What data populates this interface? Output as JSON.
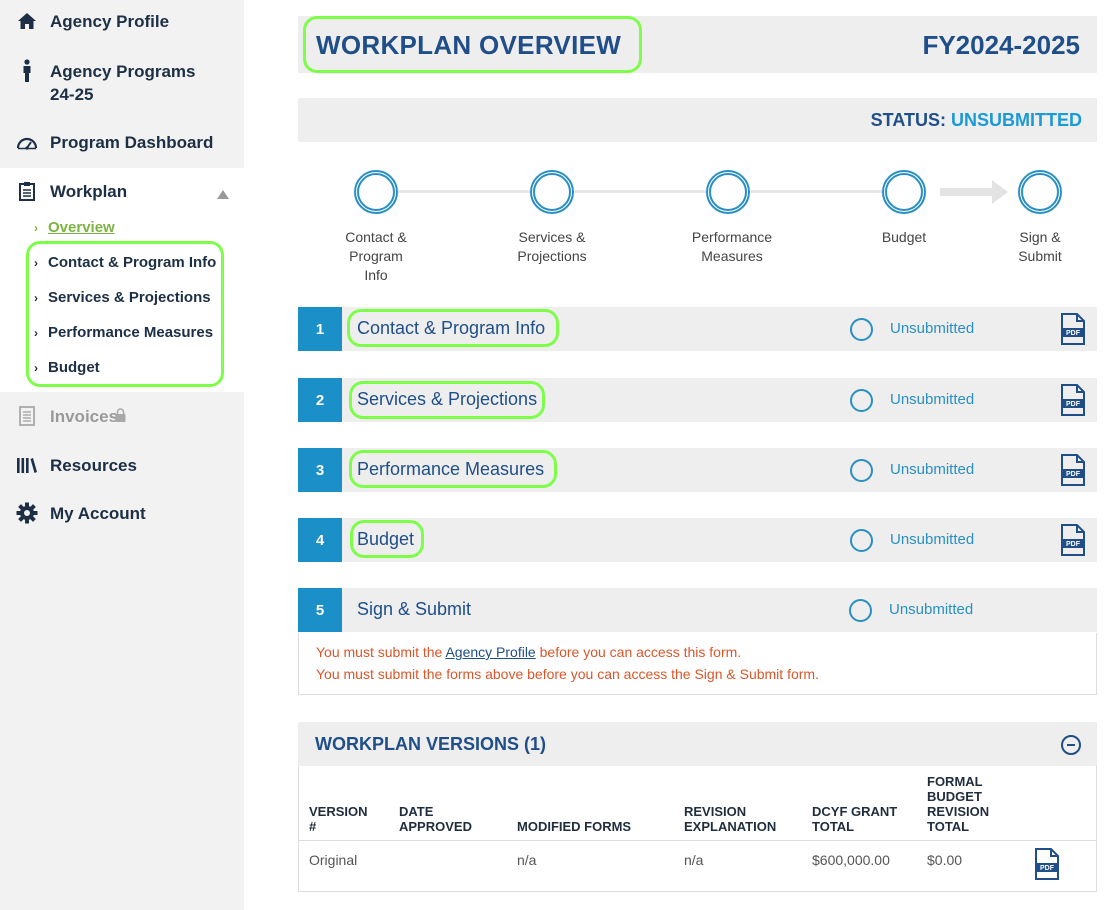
{
  "sidebar": {
    "agency_profile": "Agency Profile",
    "agency_programs": "Agency Programs",
    "agency_programs_year": "24-25",
    "program_dashboard": "Program Dashboard",
    "workplan": "Workplan",
    "sub_items": [
      "Overview",
      "Contact & Program Info",
      "Services & Projections",
      "Performance Measures",
      "Budget"
    ],
    "invoices": "Invoices",
    "resources": "Resources",
    "my_account": "My Account"
  },
  "header": {
    "title": "WORKPLAN OVERVIEW",
    "fiscal_year": "FY2024-2025"
  },
  "status": {
    "label": "STATUS:",
    "value": "UNSUBMITTED"
  },
  "steps": [
    {
      "line1": "Contact &",
      "line2": "Program",
      "line3": "Info"
    },
    {
      "line1": "Services &",
      "line2": "Projections",
      "line3": ""
    },
    {
      "line1": "Performance",
      "line2": "Measures",
      "line3": ""
    },
    {
      "line1": "Budget",
      "line2": "",
      "line3": ""
    },
    {
      "line1": "Sign &",
      "line2": "Submit",
      "line3": ""
    }
  ],
  "forms": [
    {
      "num": "1",
      "title": "Contact & Program Info",
      "status": "Unsubmitted"
    },
    {
      "num": "2",
      "title": "Services & Projections",
      "status": "Unsubmitted"
    },
    {
      "num": "3",
      "title": "Performance Measures",
      "status": "Unsubmitted"
    },
    {
      "num": "4",
      "title": "Budget",
      "status": "Unsubmitted"
    },
    {
      "num": "5",
      "title": "Sign & Submit",
      "status": "Unsubmitted"
    }
  ],
  "notice": {
    "line1_before": "You must submit the ",
    "line1_link": "Agency Profile",
    "line1_after": " before you can access this form.",
    "line2": "You must submit the forms above before you can access the Sign & Submit form."
  },
  "versions": {
    "title": "WORKPLAN VERSIONS (1)",
    "headers": {
      "version": [
        "VERSION",
        "#"
      ],
      "date": [
        "DATE",
        "APPROVED"
      ],
      "modified": [
        "MODIFIED FORMS"
      ],
      "revision": [
        "REVISION",
        "EXPLANATION"
      ],
      "grant": [
        "DCYF GRANT",
        "TOTAL"
      ],
      "formal": [
        "FORMAL",
        "BUDGET",
        "REVISION",
        "TOTAL"
      ]
    },
    "row": {
      "version": "Original",
      "date": "",
      "modified": "n/a",
      "revision": "n/a",
      "grant": "$600,000.00",
      "formal": "$0.00"
    }
  },
  "pdf_label": "PDF",
  "colors": {
    "brand_blue": "#1f4e88",
    "accent_blue": "#1b8fc7",
    "highlight_green": "#7dff4a",
    "error_red": "#d9572b"
  }
}
